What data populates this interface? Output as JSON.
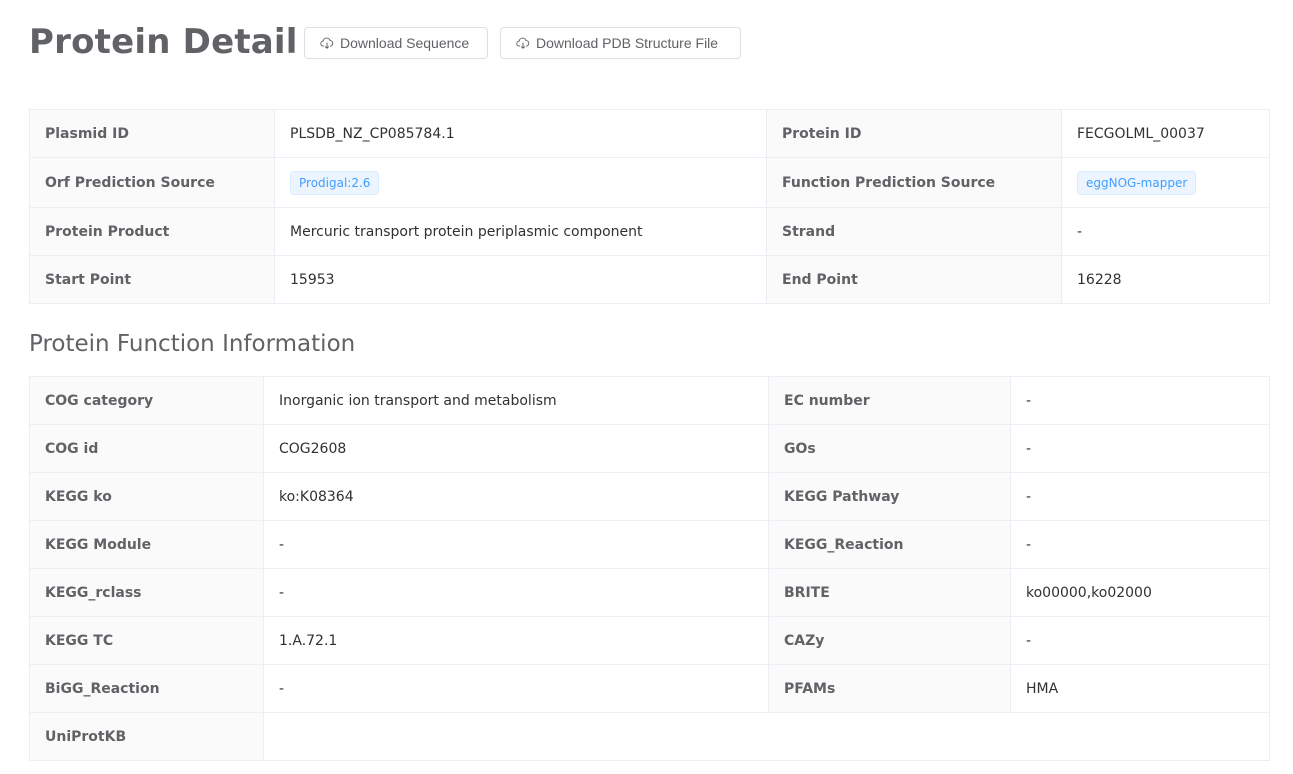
{
  "page": {
    "title": "Protein Detail"
  },
  "actions": {
    "download_sequence": "Download Sequence",
    "download_pdb": "Download PDB Structure File"
  },
  "basic": {
    "plasmid_id_label": "Plasmid ID",
    "plasmid_id_value": "PLSDB_NZ_CP085784.1",
    "protein_id_label": "Protein ID",
    "protein_id_value": "FECGOLML_00037",
    "orf_source_label": "Orf Prediction Source",
    "orf_source_value": "Prodigal:2.6",
    "function_source_label": "Function Prediction Source",
    "function_source_value": "eggNOG-mapper",
    "product_label": "Protein Product",
    "product_value": "Mercuric transport protein periplasmic component",
    "strand_label": "Strand",
    "strand_value": "-",
    "start_label": "Start Point",
    "start_value": "15953",
    "end_label": "End Point",
    "end_value": "16228"
  },
  "function_section": {
    "title": "Protein Function Information",
    "rows": [
      {
        "l1": "COG category",
        "v1": "Inorganic ion transport and metabolism",
        "l2": "EC number",
        "v2": "-"
      },
      {
        "l1": "COG id",
        "v1": "COG2608",
        "l2": "GOs",
        "v2": "-"
      },
      {
        "l1": "KEGG ko",
        "v1": "ko:K08364",
        "l2": "KEGG Pathway",
        "v2": "-"
      },
      {
        "l1": "KEGG Module",
        "v1": "-",
        "l2": "KEGG_Reaction",
        "v2": "-"
      },
      {
        "l1": "KEGG_rclass",
        "v1": "-",
        "l2": "BRITE",
        "v2": "ko00000,ko02000"
      },
      {
        "l1": "KEGG TC",
        "v1": "1.A.72.1",
        "l2": "CAZy",
        "v2": "-"
      },
      {
        "l1": "BiGG_Reaction",
        "v1": "-",
        "l2": "PFAMs",
        "v2": "HMA"
      }
    ],
    "uniprot_label": "UniProtKB",
    "uniprot_value": ""
  },
  "icons": {
    "download": "cloud-download-icon"
  },
  "colors": {
    "tag_text": "#409eff",
    "tag_bg": "#ecf5ff",
    "label_bg": "#fafafa",
    "border": "#ebeef5"
  }
}
